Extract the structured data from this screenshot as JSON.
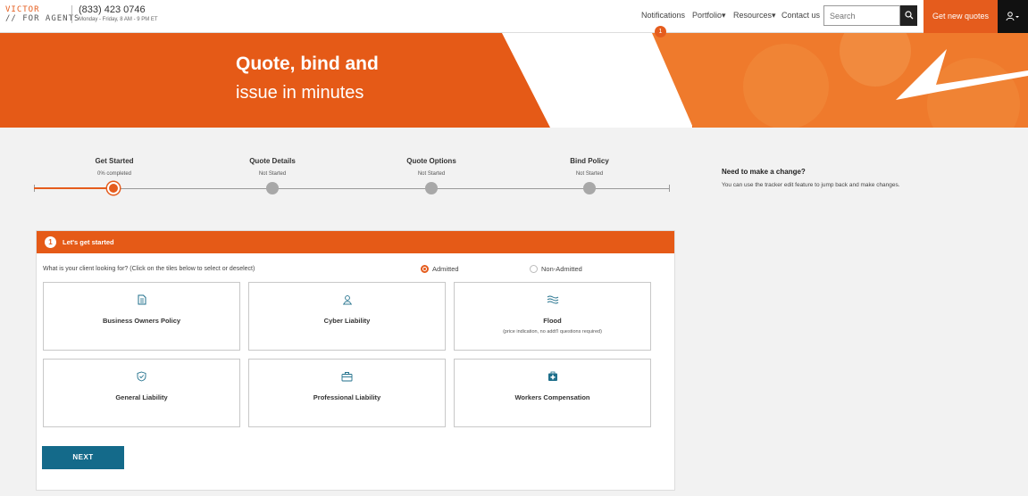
{
  "brand": {
    "logo_line1": "VICTOR",
    "logo_line2": "// FOR AGENTS",
    "phone": "(833) 423 0746",
    "hours": "Monday - Friday, 8 AM - 9 PM ET"
  },
  "nav": {
    "notifications": "Notifications",
    "notifications_count": "1",
    "portfolio": "Portfolio▾",
    "resources": "Resources▾",
    "contact": "Contact us",
    "search_placeholder": "Search",
    "get_quotes": "Get new quotes",
    "search_icon": "search-icon",
    "user_icon": "user-icon"
  },
  "hero": {
    "title": "Quote, bind and",
    "subtitle": "issue in minutes"
  },
  "tracker": {
    "steps": [
      {
        "name": "Get Started",
        "status": "0% completed",
        "state": "active"
      },
      {
        "name": "Quote Details",
        "status": "Not Started",
        "state": "pending"
      },
      {
        "name": "Quote Options",
        "status": "Not Started",
        "state": "pending"
      },
      {
        "name": "Bind Policy",
        "status": "Not Started",
        "state": "pending"
      }
    ],
    "side_title": "Need to make a change?",
    "side_text": "You can use the tracker edit feature to jump back and make changes."
  },
  "card": {
    "step_number": "1",
    "header": "Let's get started",
    "question": "What is your client looking for? (Click on the tiles below to select or deselect)",
    "radios": [
      {
        "label": "Admitted",
        "checked": true
      },
      {
        "label": "Non-Admitted",
        "checked": false
      }
    ],
    "tiles": [
      {
        "label": "Business Owners Policy",
        "note": "",
        "icon": "document-icon"
      },
      {
        "label": "Cyber Liability",
        "note": "",
        "icon": "cyber-person-icon"
      },
      {
        "label": "Flood",
        "note": "(price indication, no addt'l questions required)",
        "icon": "waves-icon"
      },
      {
        "label": "General Liability",
        "note": "",
        "icon": "shield-check-icon"
      },
      {
        "label": "Professional Liability",
        "note": "",
        "icon": "briefcase-icon"
      },
      {
        "label": "Workers Compensation",
        "note": "",
        "icon": "medical-kit-icon"
      }
    ],
    "next_label": "NEXT"
  },
  "colors": {
    "accent": "#e55c1d",
    "button_blue": "#146a8a",
    "icon_teal": "#1f6f8b"
  }
}
